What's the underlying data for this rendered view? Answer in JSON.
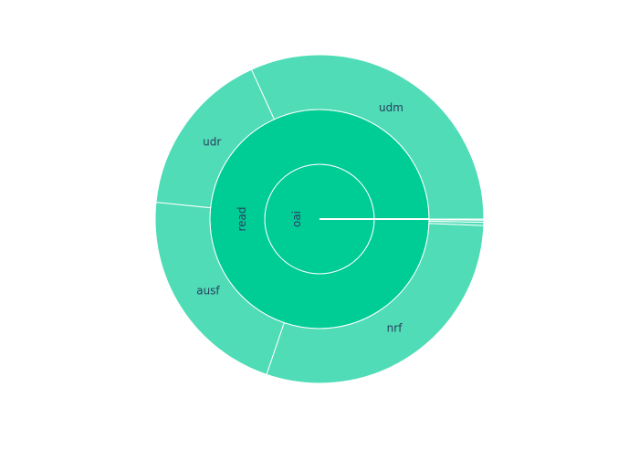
{
  "chart_data": {
    "type": "sunburst",
    "title": "",
    "root": {
      "label": "oai",
      "value": 1.0,
      "children": [
        {
          "label": "read",
          "value": 1.0,
          "children": [
            {
              "label": "udm",
              "value": 0.303
            },
            {
              "label": "udr",
              "value": 0.158
            },
            {
              "label": "ausf",
              "value": 0.204
            },
            {
              "label": "nrf",
              "value": 0.282
            },
            {
              "label": "",
              "value": 0.003
            },
            {
              "label": "",
              "value": 0.002
            },
            {
              "label": "",
              "value": 0.001
            }
          ]
        }
      ]
    },
    "start_angle_deg": 0,
    "direction": "counterclockwise",
    "colors": {
      "root": "#00cc96",
      "ring1": "#00cc96",
      "ring2": "#4fdcb6",
      "separator": "#ffffff",
      "label": "#2a3f5f"
    }
  }
}
